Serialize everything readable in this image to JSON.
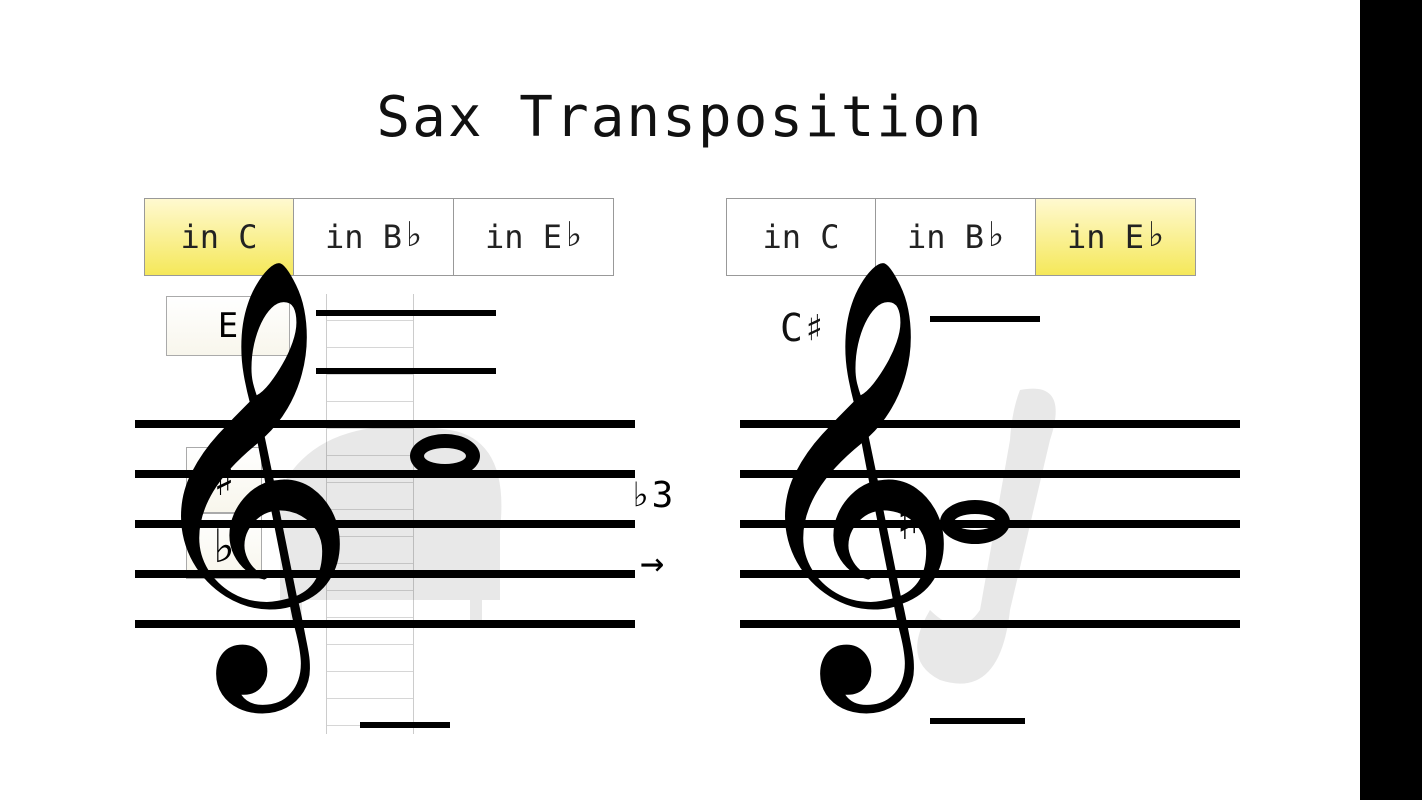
{
  "title": "Sax Transposition",
  "tabs": {
    "left": {
      "c": "in C",
      "bb": "in B",
      "eb": "in E",
      "selected": "c"
    },
    "right": {
      "c": "in C",
      "bb": "in B",
      "eb": "in E",
      "selected": "eb"
    },
    "flat_glyph": "♭"
  },
  "left": {
    "note_name": "E",
    "sharp_button": "♯",
    "flat_button": "♭"
  },
  "right": {
    "note_name": "C♯",
    "accidental_on_staff": "♯"
  },
  "interval": {
    "label": "♭3",
    "arrow": "→"
  },
  "glyphs": {
    "treble_clef": "𝄞"
  }
}
